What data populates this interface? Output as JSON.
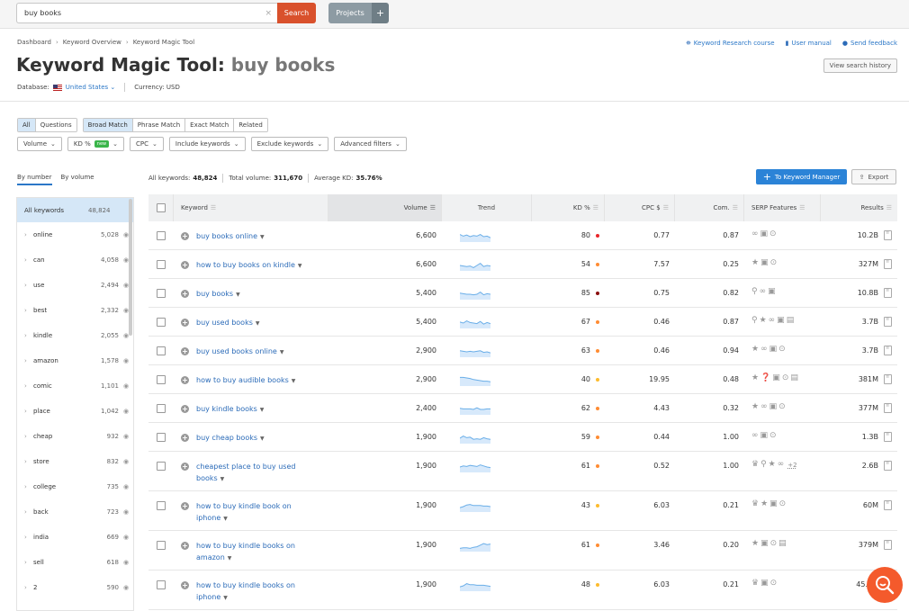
{
  "topbar": {
    "search_value": "buy books",
    "clear_icon": "×",
    "search_label": "Search",
    "projects_label": "Projects",
    "projects_plus": "+"
  },
  "breadcrumb": [
    "Dashboard",
    "Keyword Overview",
    "Keyword Magic Tool"
  ],
  "breadcrumb_sep": "›",
  "toplinks": [
    {
      "icon": "graduation-cap-icon",
      "glyph": "🎓",
      "label": "Keyword Research course"
    },
    {
      "icon": "book-icon",
      "glyph": "■",
      "label": "User manual"
    },
    {
      "icon": "chat-bubble-icon",
      "glyph": "●",
      "label": "Send feedback"
    }
  ],
  "title": {
    "prefix": "Keyword Magic Tool:",
    "query": "buy books"
  },
  "history_label": "View search history",
  "database": {
    "label": "Database:",
    "value": "United States",
    "currency": "Currency: USD"
  },
  "segments": {
    "group1": [
      {
        "label": "All",
        "active": true
      },
      {
        "label": "Questions",
        "active": false
      }
    ],
    "group2": [
      {
        "label": "Broad Match",
        "active": true
      },
      {
        "label": "Phrase Match",
        "active": false
      },
      {
        "label": "Exact Match",
        "active": false
      },
      {
        "label": "Related",
        "active": false
      }
    ]
  },
  "filters": [
    {
      "label": "Volume"
    },
    {
      "label": "KD %",
      "badge": "new"
    },
    {
      "label": "CPC"
    },
    {
      "label": "Include keywords"
    },
    {
      "label": "Exclude keywords"
    },
    {
      "label": "Advanced filters"
    }
  ],
  "sidetabs": [
    "By number",
    "By volume"
  ],
  "sidebar": {
    "all": {
      "label": "All keywords",
      "count": "48,824"
    },
    "items": [
      {
        "label": "online",
        "count": "5,028"
      },
      {
        "label": "can",
        "count": "4,058"
      },
      {
        "label": "use",
        "count": "2,494"
      },
      {
        "label": "best",
        "count": "2,332"
      },
      {
        "label": "kindle",
        "count": "2,055"
      },
      {
        "label": "amazon",
        "count": "1,578"
      },
      {
        "label": "comic",
        "count": "1,101"
      },
      {
        "label": "place",
        "count": "1,042"
      },
      {
        "label": "cheap",
        "count": "932"
      },
      {
        "label": "store",
        "count": "832"
      },
      {
        "label": "college",
        "count": "735"
      },
      {
        "label": "back",
        "count": "723"
      },
      {
        "label": "india",
        "count": "669"
      },
      {
        "label": "sell",
        "count": "618"
      },
      {
        "label": "2",
        "count": "590"
      }
    ]
  },
  "stats": {
    "all_label": "All keywords:",
    "all_value": "48,824",
    "vol_label": "Total volume:",
    "vol_value": "311,670",
    "kd_label": "Average KD:",
    "kd_value": "35.76%"
  },
  "actions": {
    "keyword_manager": "To Keyword Manager",
    "export": "Export"
  },
  "columns": [
    "Keyword",
    "Volume",
    "Trend",
    "KD %",
    "CPC $",
    "Com.",
    "SERP Features",
    "Results"
  ],
  "kd_colors": {
    "very_hard": "#8b0f0f",
    "hard": "#e8262a",
    "difficult": "#ff8c33",
    "possible": "#fdbb2e"
  },
  "rows": [
    {
      "keyword": "buy books online",
      "volume": "6,600",
      "trend": [
        0.7,
        0.55,
        0.65,
        0.5,
        0.6,
        0.55,
        0.7,
        0.5,
        0.55,
        0.4
      ],
      "kd": "80",
      "kd_color": "#e8262a",
      "cpc": "0.77",
      "com": "0.87",
      "serp": [
        "link-icon",
        "review-icon",
        "video-icon"
      ],
      "serp_more": "",
      "results": "10.2B"
    },
    {
      "keyword": "how to buy books on kindle",
      "volume": "6,600",
      "trend": [
        0.5,
        0.45,
        0.4,
        0.45,
        0.3,
        0.5,
        0.7,
        0.4,
        0.5,
        0.45
      ],
      "kd": "54",
      "kd_color": "#ff8c33",
      "cpc": "7.57",
      "com": "0.25",
      "serp": [
        "star-icon",
        "review-icon",
        "video-icon"
      ],
      "serp_more": "",
      "results": "327M"
    },
    {
      "keyword": "buy books",
      "volume": "5,400",
      "trend": [
        0.6,
        0.55,
        0.5,
        0.5,
        0.45,
        0.5,
        0.7,
        0.45,
        0.55,
        0.5
      ],
      "kd": "85",
      "kd_color": "#8b0f0f",
      "cpc": "0.75",
      "com": "0.82",
      "serp": [
        "pin-icon",
        "link-icon",
        "review-icon"
      ],
      "serp_more": "",
      "results": "10.8B"
    },
    {
      "keyword": "buy used books",
      "volume": "5,400",
      "trend": [
        0.6,
        0.5,
        0.7,
        0.55,
        0.5,
        0.45,
        0.65,
        0.4,
        0.55,
        0.45
      ],
      "kd": "67",
      "kd_color": "#ff8c33",
      "cpc": "0.46",
      "com": "0.87",
      "serp": [
        "pin-icon",
        "star-icon",
        "link-icon",
        "review-icon",
        "ad-icon"
      ],
      "serp_more": "",
      "results": "3.7B"
    },
    {
      "keyword": "buy used books online",
      "volume": "2,900",
      "trend": [
        0.6,
        0.55,
        0.5,
        0.55,
        0.5,
        0.55,
        0.6,
        0.45,
        0.5,
        0.4
      ],
      "kd": "63",
      "kd_color": "#ff8c33",
      "cpc": "0.46",
      "com": "0.94",
      "serp": [
        "star-icon",
        "link-icon",
        "review-icon",
        "video-icon"
      ],
      "serp_more": "",
      "results": "3.7B"
    },
    {
      "keyword": "how to buy audible books",
      "volume": "2,900",
      "trend": [
        0.8,
        0.8,
        0.75,
        0.7,
        0.6,
        0.55,
        0.5,
        0.45,
        0.45,
        0.4
      ],
      "kd": "40",
      "kd_color": "#fdbb2e",
      "cpc": "19.95",
      "com": "0.48",
      "serp": [
        "star-icon",
        "question-icon",
        "review-icon",
        "video-icon",
        "ad-icon"
      ],
      "serp_more": "",
      "results": "381M"
    },
    {
      "keyword": "buy kindle books",
      "volume": "2,400",
      "trend": [
        0.6,
        0.55,
        0.55,
        0.55,
        0.5,
        0.65,
        0.5,
        0.5,
        0.55,
        0.55
      ],
      "kd": "62",
      "kd_color": "#ff8c33",
      "cpc": "4.43",
      "com": "0.32",
      "serp": [
        "star-icon",
        "link-icon",
        "review-icon",
        "video-icon"
      ],
      "serp_more": "",
      "results": "377M"
    },
    {
      "keyword": "buy cheap books",
      "volume": "1,900",
      "trend": [
        0.5,
        0.7,
        0.55,
        0.6,
        0.4,
        0.45,
        0.4,
        0.55,
        0.45,
        0.4
      ],
      "kd": "59",
      "kd_color": "#ff8c33",
      "cpc": "0.44",
      "com": "1.00",
      "serp": [
        "link-icon",
        "review-icon",
        "video-icon"
      ],
      "serp_more": "",
      "results": "1.3B"
    },
    {
      "keyword": "cheapest place to buy used books",
      "volume": "1,900",
      "trend": [
        0.5,
        0.6,
        0.55,
        0.65,
        0.6,
        0.55,
        0.7,
        0.6,
        0.5,
        0.45
      ],
      "kd": "61",
      "kd_color": "#ff8c33",
      "cpc": "0.52",
      "com": "1.00",
      "serp": [
        "crown-icon",
        "pin-icon",
        "star-icon",
        "link-icon"
      ],
      "serp_more": "+2",
      "results": "2.6B"
    },
    {
      "keyword": "how to buy kindle book on iphone",
      "volume": "1,900",
      "trend": [
        0.4,
        0.5,
        0.65,
        0.7,
        0.6,
        0.6,
        0.6,
        0.55,
        0.55,
        0.5
      ],
      "kd": "43",
      "kd_color": "#fdbb2e",
      "cpc": "6.03",
      "com": "0.21",
      "serp": [
        "crown-icon",
        "star-icon",
        "review-icon",
        "video-icon"
      ],
      "serp_more": "",
      "results": "60M"
    },
    {
      "keyword": "how to buy kindle books on amazon",
      "volume": "1,900",
      "trend": [
        0.3,
        0.35,
        0.35,
        0.3,
        0.4,
        0.45,
        0.6,
        0.75,
        0.65,
        0.7
      ],
      "kd": "61",
      "kd_color": "#ff8c33",
      "cpc": "3.46",
      "com": "0.20",
      "serp": [
        "star-icon",
        "review-icon",
        "video-icon",
        "ad-icon"
      ],
      "serp_more": "",
      "results": "379M"
    },
    {
      "keyword": "how to buy kindle books on iphone",
      "volume": "1,900",
      "trend": [
        0.4,
        0.5,
        0.7,
        0.6,
        0.6,
        0.55,
        0.55,
        0.55,
        0.5,
        0.45
      ],
      "kd": "48",
      "kd_color": "#fdbb2e",
      "cpc": "6.03",
      "com": "0.21",
      "serp": [
        "crown-icon",
        "review-icon",
        "video-icon"
      ],
      "serp_more": "",
      "results": "45.5M"
    }
  ]
}
